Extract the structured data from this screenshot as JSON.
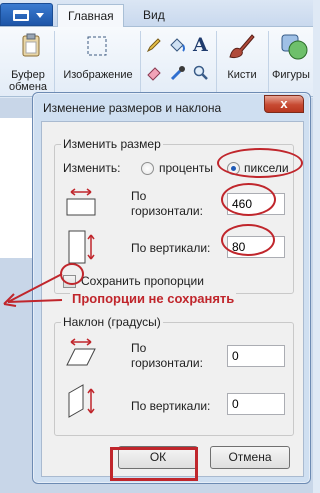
{
  "ribbon": {
    "tabs": [
      "Главная",
      "Вид"
    ],
    "groups": {
      "clipboard": [
        "Буфер",
        "обмена"
      ],
      "image": "Изображение",
      "brushes": "Кисти",
      "shapes": "Фигуры"
    }
  },
  "dialog": {
    "title": "Изменение размеров и наклона",
    "close": "x",
    "resize": {
      "group_label": "Изменить размер",
      "by_label": "Изменить:",
      "option_percent": "проценты",
      "option_pixels": "пиксели",
      "horizontal_label": [
        "По",
        "горизонтали:"
      ],
      "horizontal_value": "460",
      "vertical_label": "По вертикали:",
      "vertical_value": "80",
      "keep_ratio_label": "Сохранить пропорции",
      "keep_ratio_checked": false
    },
    "skew": {
      "group_label": "Наклон (градусы)",
      "horizontal_label": [
        "По",
        "горизонтали:"
      ],
      "horizontal_value": "0",
      "vertical_label": "По вертикали:",
      "vertical_value": "0"
    },
    "ok": "ОК",
    "cancel": "Отмена"
  },
  "annotation": "Пропорции не сохранять",
  "colors": {
    "highlight": "#c0262c",
    "accent": "#1f5ab6"
  }
}
